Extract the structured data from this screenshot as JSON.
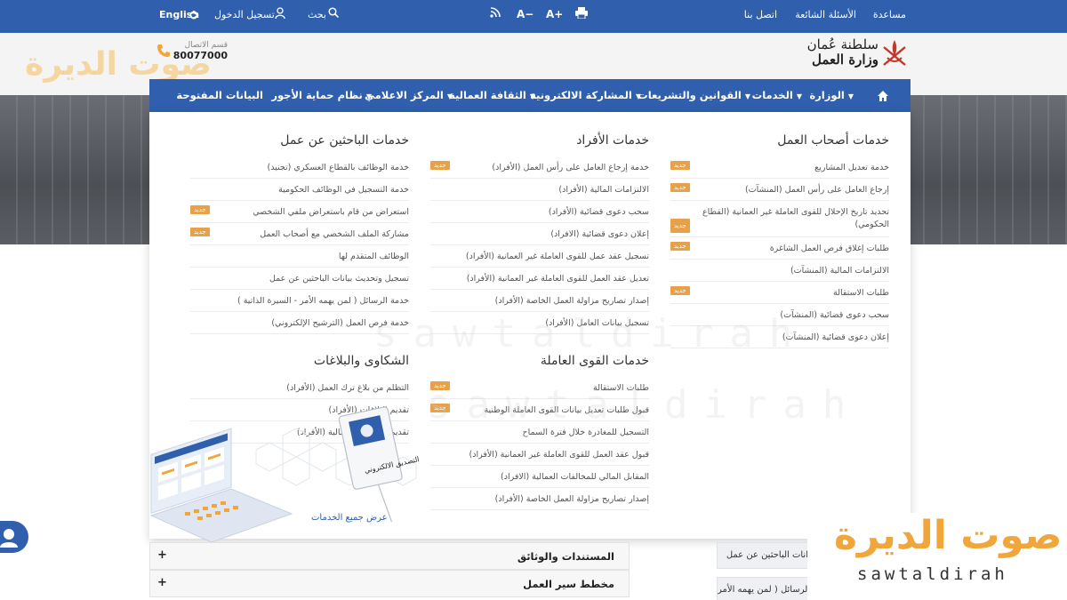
{
  "topbar": {
    "help": "مساعدة",
    "faq": "الأسئلة الشائعة",
    "contact": "اتصل بنا",
    "search": "بحث",
    "login": "تسجيل الدخول",
    "english": "English",
    "font_increase": "A+",
    "font_decrease": "A−"
  },
  "header": {
    "logo_line1": "سلطنة عُمان",
    "logo_line2": "وزارة العمل",
    "call_label": "قسم الاتصال",
    "call_number": "80077000"
  },
  "nav": {
    "items": [
      "الوزارة",
      "الخدمات",
      "القوانين والتشريعات",
      "المشاركة الالكترونية",
      "الثقافة العمالية",
      "المركز الاعلامي",
      "نظام حماية الأجور",
      "البيانات المفتوحة"
    ]
  },
  "badge": "جديد",
  "menu": {
    "employers": {
      "title": "خدمات أصحاب العمل",
      "items": [
        "خدمة تعديل المشاريع",
        "إرجاع العامل على رأس العمل (المنشآت)",
        "تحديد تاريخ الإحلال للقوى العاملة غير العمانية (القطاع الحكومي)",
        "طلبات إغلاق فرص العمل الشاغرة",
        "الالتزامات المالية (المنشآت)",
        "طلبات الاستقالة",
        "سحب دعوى قضائية (المنشآت)",
        "إعلان دعوى قضائية (المنشآت)"
      ]
    },
    "individuals": {
      "title": "خدمات الأفراد",
      "items": [
        "خدمة إرجاع العامل على رأس العمل (الأفراد)",
        "الالتزامات المالية (الأفراد)",
        "سحب دعوى قضائية (الأفراد)",
        "إعلان دعوى قضائية (الافراد)",
        "تسجيل عقد عمل للقوى العاملة غير العمانية (الأفراد)",
        "تعديل عقد العمل للقوى العاملة غير العمانية (الأفراد)",
        "إصدار تصاريح مزاولة العمل الخاصة (الأفراد)",
        "تسجيل بيانات العامل (الأفراد)"
      ]
    },
    "jobseekers": {
      "title": "خدمات الباحثين عن عمل",
      "items": [
        "خدمة الوظائف بالقطاع العسكري (تجنيد)",
        "خدمة التسجيل في الوظائف الحكومية",
        "استعراض من قام باستعراض ملفي الشخصي",
        "مشاركة الملف الشخصي مع أصحاب العمل",
        "الوظائف المتقدم لها",
        "تسجيل وتحديث بيانات الباحثين عن عمل",
        "خدمة الرسائل ( لمن يهمه الأمر - السيرة الذاتية )",
        "خدمة فرص العمل (الترشيح الإلكتروني)"
      ]
    },
    "workforce": {
      "title": "خدمات القوى العاملة",
      "items": [
        "طلبات الاستقالة",
        "قبول طلبات تعديل بيانات القوى العاملة الوطنية",
        "التسجيل للمغادرة خلال فترة السماح",
        "قبول عقد العمل للقوى العاملة غير العمانية (الأفراد)",
        "المقابل المالي للمخالفات العمالية (الافراد)",
        "إصدار تصاريح مزاولة العمل الخاصة (الأفراد)"
      ]
    },
    "complaints": {
      "title": "الشكاوى والبلاغات",
      "items": [
        "التظلم من بلاغ ترك العمل (الأفراد)",
        "تقديم البلاغات (الأفراد)",
        "تقديم الشكاوى العمالية (الأفراد)"
      ]
    },
    "all_services": "عرض جميع الخدمات",
    "illustration_label": "التصديق الالكتروني"
  },
  "page": {
    "accordion": [
      "المستندات والوثائق",
      "مخطط سير العمل"
    ],
    "side_cards": [
      "انات الباحثين عن عمل",
      "خدمة الرسائل ( لمن يهمه الأمر -"
    ]
  },
  "watermark": {
    "arabic": "صوت الديرة",
    "latin": "sawtaldirah"
  },
  "colors": {
    "primary": "#2f5fad",
    "badge": "#e8a14b",
    "watermark_orange": "#f0a63a"
  }
}
